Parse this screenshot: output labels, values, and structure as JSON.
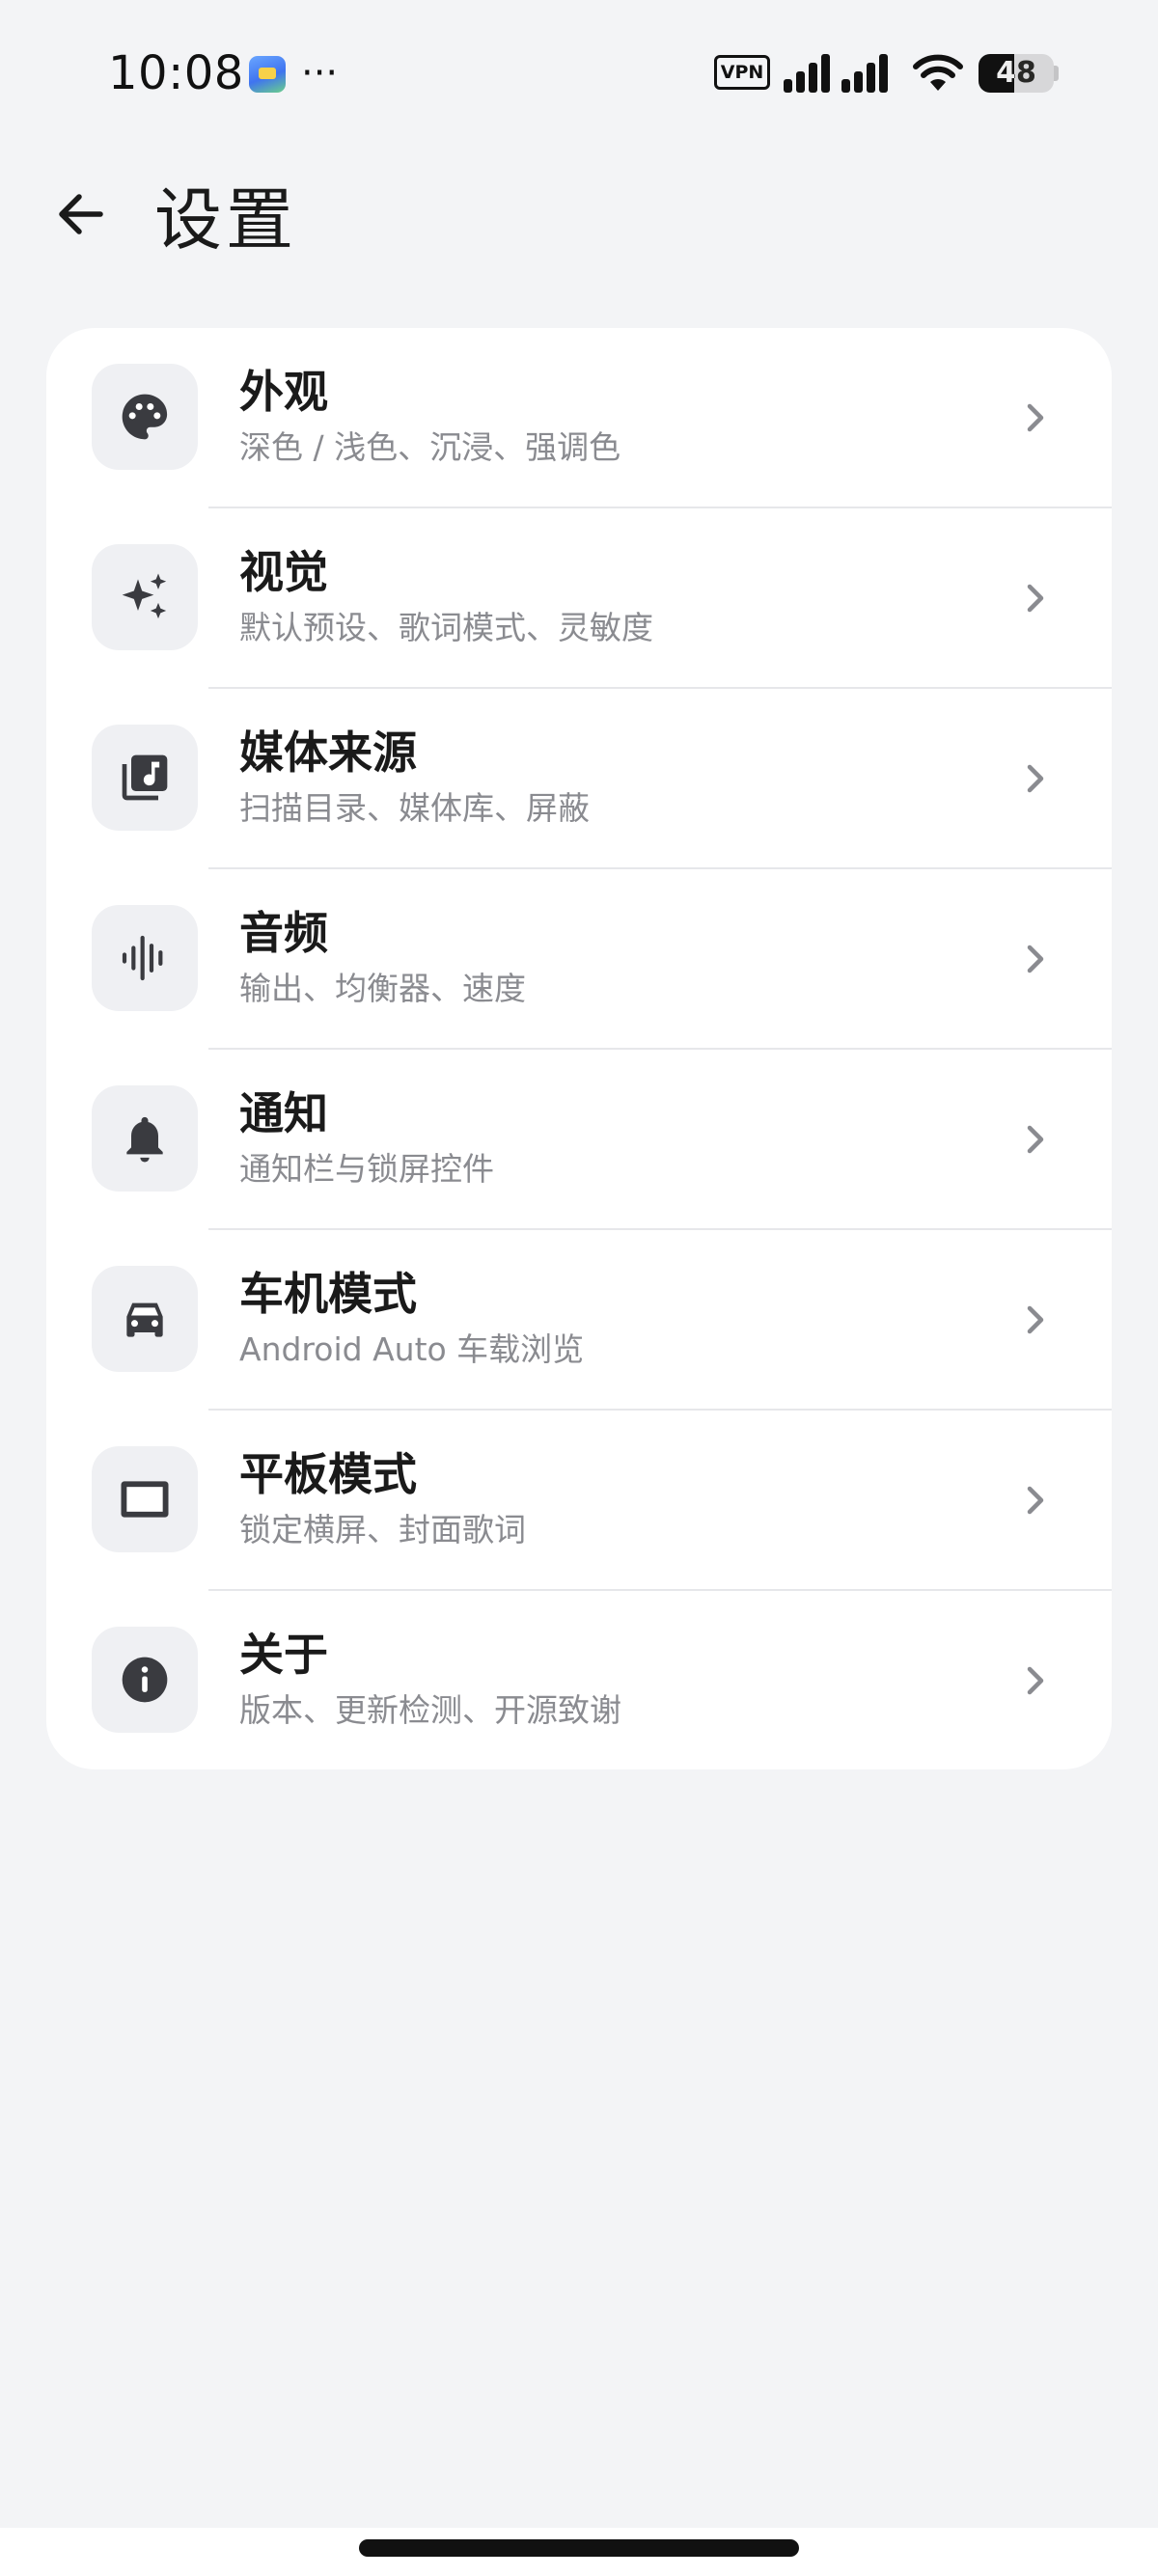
{
  "status_bar": {
    "time": "10:08",
    "more_indicator": "···",
    "vpn_label": "VPN",
    "battery_level": "48",
    "battery_fraction": 0.48,
    "icons": [
      "app-notification-icon",
      "vpn-icon",
      "signal-icon",
      "wifi-icon",
      "battery-icon"
    ]
  },
  "app_bar": {
    "title": "设置",
    "back_icon": "arrow-left-icon"
  },
  "settings": {
    "items": [
      {
        "title": "外观",
        "subtitle": "深色 / 浅色、沉浸、强调色",
        "icon": "palette-icon"
      },
      {
        "title": "视觉",
        "subtitle": "默认预设、歌词模式、灵敏度",
        "icon": "sparkles-icon"
      },
      {
        "title": "媒体来源",
        "subtitle": "扫描目录、媒体库、屏蔽",
        "icon": "music-library-icon"
      },
      {
        "title": "音频",
        "subtitle": "输出、均衡器、速度",
        "icon": "waveform-icon"
      },
      {
        "title": "通知",
        "subtitle": "通知栏与锁屏控件",
        "icon": "bell-icon"
      },
      {
        "title": "车机模式",
        "subtitle": "Android Auto 车载浏览",
        "icon": "car-icon"
      },
      {
        "title": "平板模式",
        "subtitle": "锁定横屏、封面歌词",
        "icon": "tablet-icon"
      },
      {
        "title": "关于",
        "subtitle": "版本、更新检测、开源致谢",
        "icon": "info-icon"
      }
    ]
  },
  "colors": {
    "background": "#f3f4f6",
    "card": "#ffffff",
    "icon_box": "#eff0f3",
    "icon": "#3a3b40",
    "title_text": "#1a1a1a",
    "subtitle_text": "#8a8b90",
    "chevron": "#8a8b90"
  }
}
